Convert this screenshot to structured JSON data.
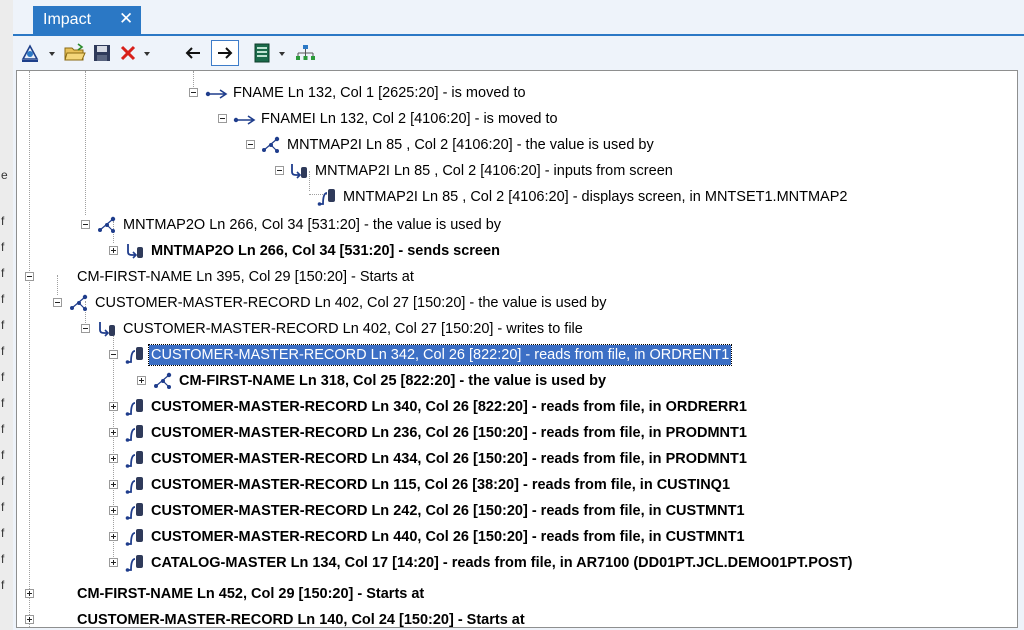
{
  "left_margin": [
    "e",
    "f",
    "f",
    "f",
    "f",
    "f",
    "f",
    "f",
    "f",
    "f",
    "f",
    "f",
    "f",
    "f",
    "f",
    "f"
  ],
  "tab": {
    "title": "Impact",
    "close": "✕"
  },
  "toolbar": {
    "buttons": [
      "impact-analysis",
      "open-folder",
      "save",
      "delete",
      "back",
      "forward",
      "export",
      "hierarchy"
    ]
  },
  "colors": {
    "accent": "#2b78c5",
    "selection": "#3c6fc5",
    "arrow_icon": "#1f3d8c"
  },
  "tree": [
    {
      "text": "FNAME Ln 132, Col 1 [2625:20] - is moved to",
      "icon": "arrow-right-icon",
      "expander": "minus",
      "bold": false
    },
    {
      "text": "FNAMEI Ln 132, Col 2 [4106:20] - is moved to",
      "icon": "arrow-right-icon",
      "expander": "minus",
      "bold": false
    },
    {
      "text": "MNTMAP2I Ln 85 , Col 2 [4106:20] - the value is used by",
      "icon": "used-by-icon",
      "expander": "minus",
      "bold": false
    },
    {
      "text": "MNTMAP2I Ln 85 , Col 2 [4106:20] - inputs from screen",
      "icon": "screen-input-icon",
      "expander": "minus",
      "bold": false
    },
    {
      "text": "MNTMAP2I Ln 85 , Col 2 [4106:20] - displays screen, in MNTSET1.MNTMAP2",
      "icon": "read-file-icon",
      "expander": "none",
      "bold": false
    },
    {
      "text": "MNTMAP2O Ln 266, Col 34 [531:20] - the value is used by",
      "icon": "used-by-icon",
      "expander": "minus",
      "bold": false
    },
    {
      "text": "MNTMAP2O Ln 266, Col 34 [531:20] - sends screen",
      "icon": "screen-input-icon",
      "expander": "plus",
      "bold": true
    },
    {
      "text": "CM-FIRST-NAME Ln 395, Col 29 [150:20] - Starts at",
      "icon": "none",
      "expander": "minus",
      "bold": false
    },
    {
      "text": "CUSTOMER-MASTER-RECORD Ln 402, Col 27 [150:20] - the value is used by",
      "icon": "used-by-icon",
      "expander": "minus",
      "bold": false
    },
    {
      "text": "CUSTOMER-MASTER-RECORD Ln 402, Col 27 [150:20] - writes to file",
      "icon": "screen-input-icon",
      "expander": "minus",
      "bold": false
    },
    {
      "text": "CUSTOMER-MASTER-RECORD Ln 342, Col 26 [822:20] - reads from file, in ORDRENT1",
      "icon": "read-file-icon",
      "expander": "minus",
      "bold": false,
      "selected": true
    },
    {
      "text": "CM-FIRST-NAME Ln 318, Col 25 [822:20] - the value is used by",
      "icon": "used-by-icon",
      "expander": "plus",
      "bold": true
    },
    {
      "text": "CUSTOMER-MASTER-RECORD Ln 340, Col 26 [822:20] - reads from file, in ORDRERR1",
      "icon": "read-file-icon",
      "expander": "plus",
      "bold": true
    },
    {
      "text": "CUSTOMER-MASTER-RECORD Ln 236, Col 26 [150:20] - reads from file, in PRODMNT1",
      "icon": "read-file-icon",
      "expander": "plus",
      "bold": true
    },
    {
      "text": "CUSTOMER-MASTER-RECORD Ln 434, Col 26 [150:20] - reads from file, in PRODMNT1",
      "icon": "read-file-icon",
      "expander": "plus",
      "bold": true
    },
    {
      "text": "CUSTOMER-MASTER-RECORD Ln 115, Col 26 [38:20] - reads from file, in CUSTINQ1",
      "icon": "read-file-icon",
      "expander": "plus",
      "bold": true
    },
    {
      "text": "CUSTOMER-MASTER-RECORD Ln 242, Col 26 [150:20] - reads from file, in CUSTMNT1",
      "icon": "read-file-icon",
      "expander": "plus",
      "bold": true
    },
    {
      "text": "CUSTOMER-MASTER-RECORD Ln 440, Col 26 [150:20] - reads from file, in CUSTMNT1",
      "icon": "read-file-icon",
      "expander": "plus",
      "bold": true
    },
    {
      "text": "CATALOG-MASTER Ln 134, Col 17 [14:20] - reads from file, in AR7100  (DD01PT.JCL.DEMO01PT.POST)",
      "icon": "read-file-icon",
      "expander": "plus",
      "bold": true
    },
    {
      "text": "CM-FIRST-NAME Ln 452, Col 29 [150:20] - Starts at",
      "icon": "none",
      "expander": "plus",
      "bold": true
    },
    {
      "text": "CUSTOMER-MASTER-RECORD Ln 140, Col 24 [150:20] - Starts at",
      "icon": "none",
      "expander": "plus",
      "bold": true
    }
  ]
}
